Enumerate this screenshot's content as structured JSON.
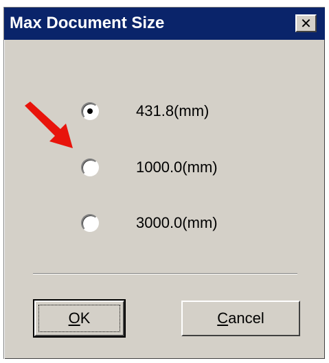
{
  "window": {
    "title": "Max Document Size",
    "close_glyph": "✕"
  },
  "options": [
    {
      "label": "431.8(mm)",
      "selected": true
    },
    {
      "label": "1000.0(mm)",
      "selected": false
    },
    {
      "label": "3000.0(mm)",
      "selected": false
    }
  ],
  "buttons": {
    "ok": {
      "mnemonic": "O",
      "rest": "K"
    },
    "cancel": {
      "mnemonic": "C",
      "rest": "ancel"
    }
  },
  "annotation": {
    "arrow_icon": "red-arrow-icon",
    "arrow_color": "#e8140c",
    "points_to_option": "1000.0(mm)"
  },
  "colors": {
    "titlebar": "#0a246a",
    "dialog_face": "#d4d0c8"
  }
}
